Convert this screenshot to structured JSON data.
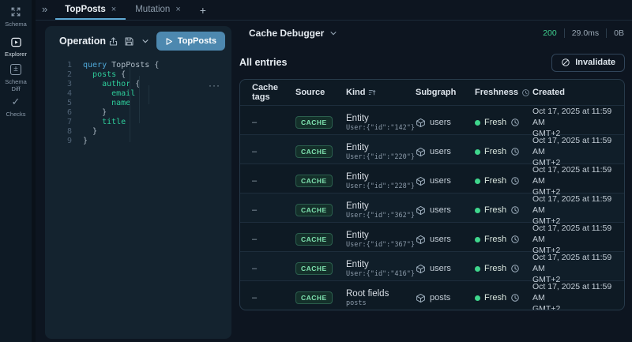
{
  "activity_bar": {
    "items": [
      {
        "label": "Schema",
        "icon": "schema-icon",
        "active": false
      },
      {
        "label": "Explorer",
        "icon": "explorer-icon",
        "active": true
      },
      {
        "label": "Schema Diff",
        "icon": "schema-diff-icon",
        "active": false
      },
      {
        "label": "Checks",
        "icon": "checks-icon",
        "active": false
      }
    ]
  },
  "tab_bar": {
    "collapse": "»",
    "tabs": [
      {
        "label": "TopPosts",
        "close": "×",
        "active": true
      },
      {
        "label": "Mutation",
        "close": "×",
        "active": false
      }
    ],
    "add_label": "+"
  },
  "editor": {
    "title": "Operation",
    "run_label": "TopPosts",
    "more": "···",
    "code": {
      "lines": [
        {
          "num": "1",
          "tokens": [
            [
              "k",
              "query"
            ],
            [
              "p",
              " TopPosts {"
            ]
          ]
        },
        {
          "num": "2",
          "tokens": [
            [
              "p",
              "  "
            ],
            [
              "f",
              "posts"
            ],
            [
              "p",
              " {"
            ]
          ]
        },
        {
          "num": "3",
          "tokens": [
            [
              "p",
              "    "
            ],
            [
              "f",
              "author"
            ],
            [
              "p",
              " {"
            ]
          ]
        },
        {
          "num": "4",
          "tokens": [
            [
              "p",
              "      "
            ],
            [
              "f",
              "email"
            ]
          ]
        },
        {
          "num": "5",
          "tokens": [
            [
              "p",
              "      "
            ],
            [
              "f",
              "name"
            ]
          ]
        },
        {
          "num": "6",
          "tokens": [
            [
              "p",
              "    }"
            ]
          ]
        },
        {
          "num": "7",
          "tokens": [
            [
              "p",
              "    "
            ],
            [
              "f",
              "title"
            ]
          ]
        },
        {
          "num": "8",
          "tokens": [
            [
              "p",
              "  }"
            ]
          ]
        },
        {
          "num": "9",
          "tokens": [
            [
              "p",
              "}"
            ]
          ]
        }
      ]
    }
  },
  "debugger": {
    "title": "Cache Debugger",
    "status": {
      "code": "200",
      "duration": "29.0ms",
      "size": "0B"
    },
    "section_title": "All entries",
    "invalidate_label": "Invalidate",
    "table": {
      "headers": [
        "Cache tags",
        "Source",
        "Kind",
        "Subgraph",
        "Freshness",
        "Created"
      ],
      "rows": [
        {
          "tags": "–",
          "source": "CACHE",
          "kind": "Entity",
          "kind_sub": "User:{\"id\":\"142\"}",
          "subgraph": "users",
          "freshness": "Fresh",
          "created": "Oct 17, 2025 at 11:59 AM",
          "created_tz": "GMT+2"
        },
        {
          "tags": "–",
          "source": "CACHE",
          "kind": "Entity",
          "kind_sub": "User:{\"id\":\"220\"}",
          "subgraph": "users",
          "freshness": "Fresh",
          "created": "Oct 17, 2025 at 11:59 AM",
          "created_tz": "GMT+2"
        },
        {
          "tags": "–",
          "source": "CACHE",
          "kind": "Entity",
          "kind_sub": "User:{\"id\":\"228\"}",
          "subgraph": "users",
          "freshness": "Fresh",
          "created": "Oct 17, 2025 at 11:59 AM",
          "created_tz": "GMT+2"
        },
        {
          "tags": "–",
          "source": "CACHE",
          "kind": "Entity",
          "kind_sub": "User:{\"id\":\"362\"}",
          "subgraph": "users",
          "freshness": "Fresh",
          "created": "Oct 17, 2025 at 11:59 AM",
          "created_tz": "GMT+2"
        },
        {
          "tags": "–",
          "source": "CACHE",
          "kind": "Entity",
          "kind_sub": "User:{\"id\":\"367\"}",
          "subgraph": "users",
          "freshness": "Fresh",
          "created": "Oct 17, 2025 at 11:59 AM",
          "created_tz": "GMT+2"
        },
        {
          "tags": "–",
          "source": "CACHE",
          "kind": "Entity",
          "kind_sub": "User:{\"id\":\"416\"}",
          "subgraph": "users",
          "freshness": "Fresh",
          "created": "Oct 17, 2025 at 11:59 AM",
          "created_tz": "GMT+2"
        },
        {
          "tags": "–",
          "source": "CACHE",
          "kind": "Root fields",
          "kind_sub": "posts",
          "subgraph": "posts",
          "freshness": "Fresh",
          "created": "Oct 17, 2025 at 11:59 AM",
          "created_tz": "GMT+2"
        }
      ]
    }
  },
  "colors": {
    "accent_blue": "#5fa9d4",
    "run_button_blue": "#4d88af",
    "status_green": "#3ecf8e",
    "badge_green": "#7fe3b0",
    "keyword_blue": "#4fa8d8",
    "field_teal": "#2ecc9a"
  }
}
